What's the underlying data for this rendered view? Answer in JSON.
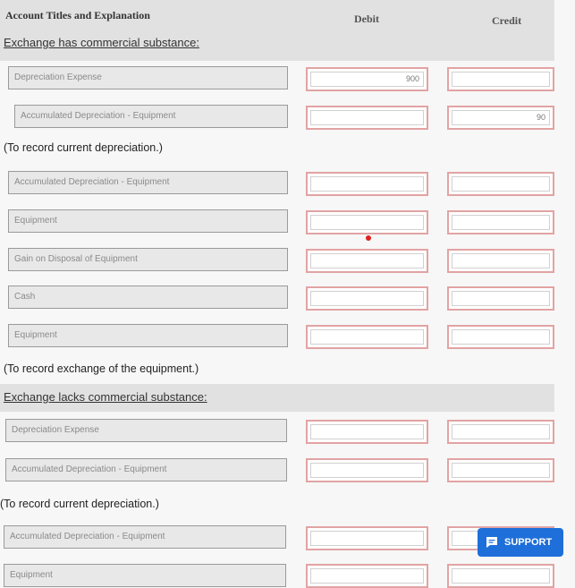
{
  "header": {
    "title": "Account Titles and Explanation",
    "debit": "Debit",
    "credit": "Credit"
  },
  "sections": {
    "commercial": "Exchange has commercial substance:",
    "lacks": "Exchange lacks commercial substance:"
  },
  "notes": {
    "record_depreciation_1": "(To record current depreciation.)",
    "record_exchange": "(To record exchange of the equipment.)",
    "record_depreciation_2": "(To record current depreciation.)"
  },
  "rows": [
    {
      "account": "Depreciation Expense",
      "debit": "900",
      "credit": ""
    },
    {
      "account": "Accumulated Depreciation - Equipment",
      "debit": "",
      "credit": "90"
    },
    {
      "account": "Accumulated Depreciation - Equipment",
      "debit": "",
      "credit": ""
    },
    {
      "account": "Equipment",
      "debit": "",
      "credit": ""
    },
    {
      "account": "Gain on Disposal of Equipment",
      "debit": "",
      "credit": ""
    },
    {
      "account": "Cash",
      "debit": "",
      "credit": ""
    },
    {
      "account": "Equipment",
      "debit": "",
      "credit": ""
    },
    {
      "account": "Depreciation Expense",
      "debit": "",
      "credit": ""
    },
    {
      "account": "Accumulated Depreciation - Equipment",
      "debit": "",
      "credit": ""
    },
    {
      "account": "Accumulated Depreciation - Equipment",
      "debit": "",
      "credit": ""
    },
    {
      "account": "Equipment",
      "debit": "",
      "credit": ""
    }
  ],
  "support": {
    "label": "SUPPORT",
    "icon": "chat-icon"
  },
  "colors": {
    "support_bg": "#1e6fd9",
    "field_border": "#e2a3a3",
    "header_bg": "#e1e1e1"
  }
}
